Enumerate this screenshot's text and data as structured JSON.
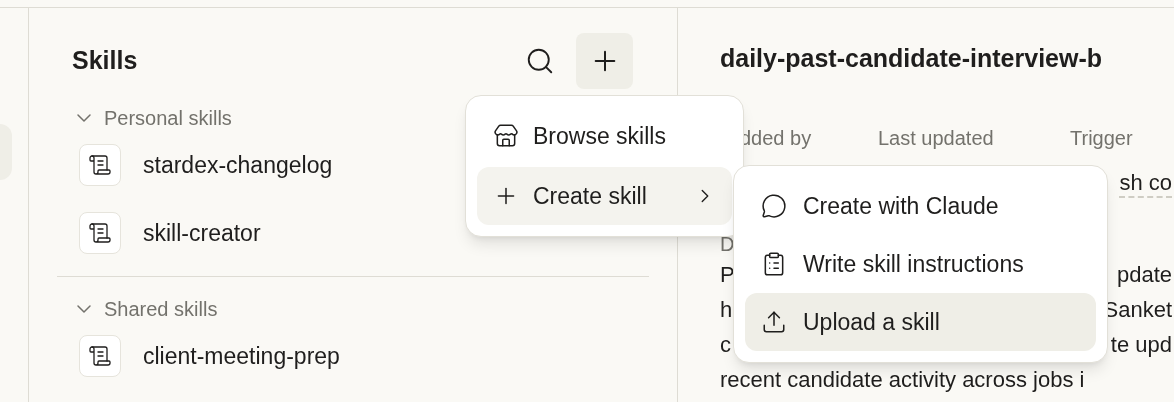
{
  "skills_panel": {
    "title": "Skills",
    "sections": [
      {
        "label": "Personal skills",
        "expanded": true,
        "items": [
          {
            "name": "stardex-changelog"
          },
          {
            "name": "skill-creator"
          }
        ]
      },
      {
        "label": "Shared skills",
        "expanded": true,
        "items": [
          {
            "name": "client-meeting-prep"
          }
        ]
      }
    ]
  },
  "detail": {
    "title": "daily-past-candidate-interview-b",
    "meta_labels": [
      "dded by",
      "Last updated",
      "Trigger"
    ],
    "trigger_value": "sh co",
    "description_label": "D",
    "description_lines": [
      {
        "left": "P",
        "right": "pdate"
      },
      {
        "left": "h",
        "right": "Sanket"
      },
      {
        "left": "c",
        "right": "te upd"
      },
      {
        "left": "recent candidate activity across jobs i"
      }
    ]
  },
  "menu": {
    "items": [
      {
        "label": "Browse skills",
        "selected": false,
        "submenu": false
      },
      {
        "label": "Create skill",
        "selected": true,
        "submenu": true
      }
    ]
  },
  "submenu": {
    "items": [
      {
        "label": "Create with Claude",
        "selected": false
      },
      {
        "label": "Write skill instructions",
        "selected": false
      },
      {
        "label": "Upload a skill",
        "selected": true
      }
    ]
  }
}
